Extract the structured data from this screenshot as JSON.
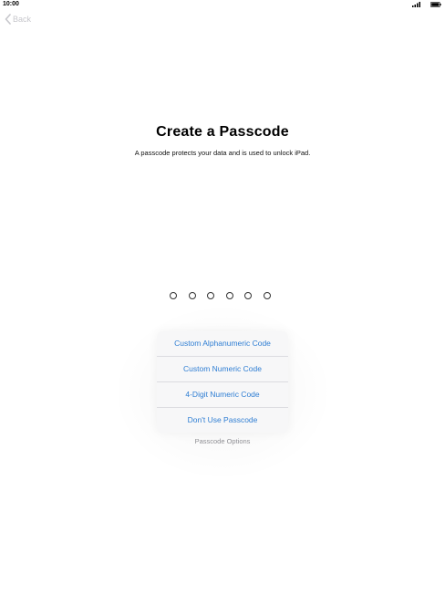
{
  "status_bar": {
    "time": "10:00",
    "icons": [
      "signal-icon",
      "battery-icon"
    ]
  },
  "nav": {
    "back_label": "Back"
  },
  "screen": {
    "title": "Create a Passcode",
    "subtitle": "A passcode protects your data and is used to unlock iPad."
  },
  "passcode": {
    "digit_count": 6
  },
  "options": {
    "items": [
      {
        "label": "Custom Alphanumeric Code"
      },
      {
        "label": "Custom Numeric Code"
      },
      {
        "label": "4-Digit Numeric Code"
      },
      {
        "label": "Don't Use Passcode"
      }
    ],
    "caption": "Passcode Options"
  },
  "colors": {
    "link": "#2f7ed3",
    "back_disabled": "#c7c7cc",
    "caption": "#8e8e93"
  }
}
